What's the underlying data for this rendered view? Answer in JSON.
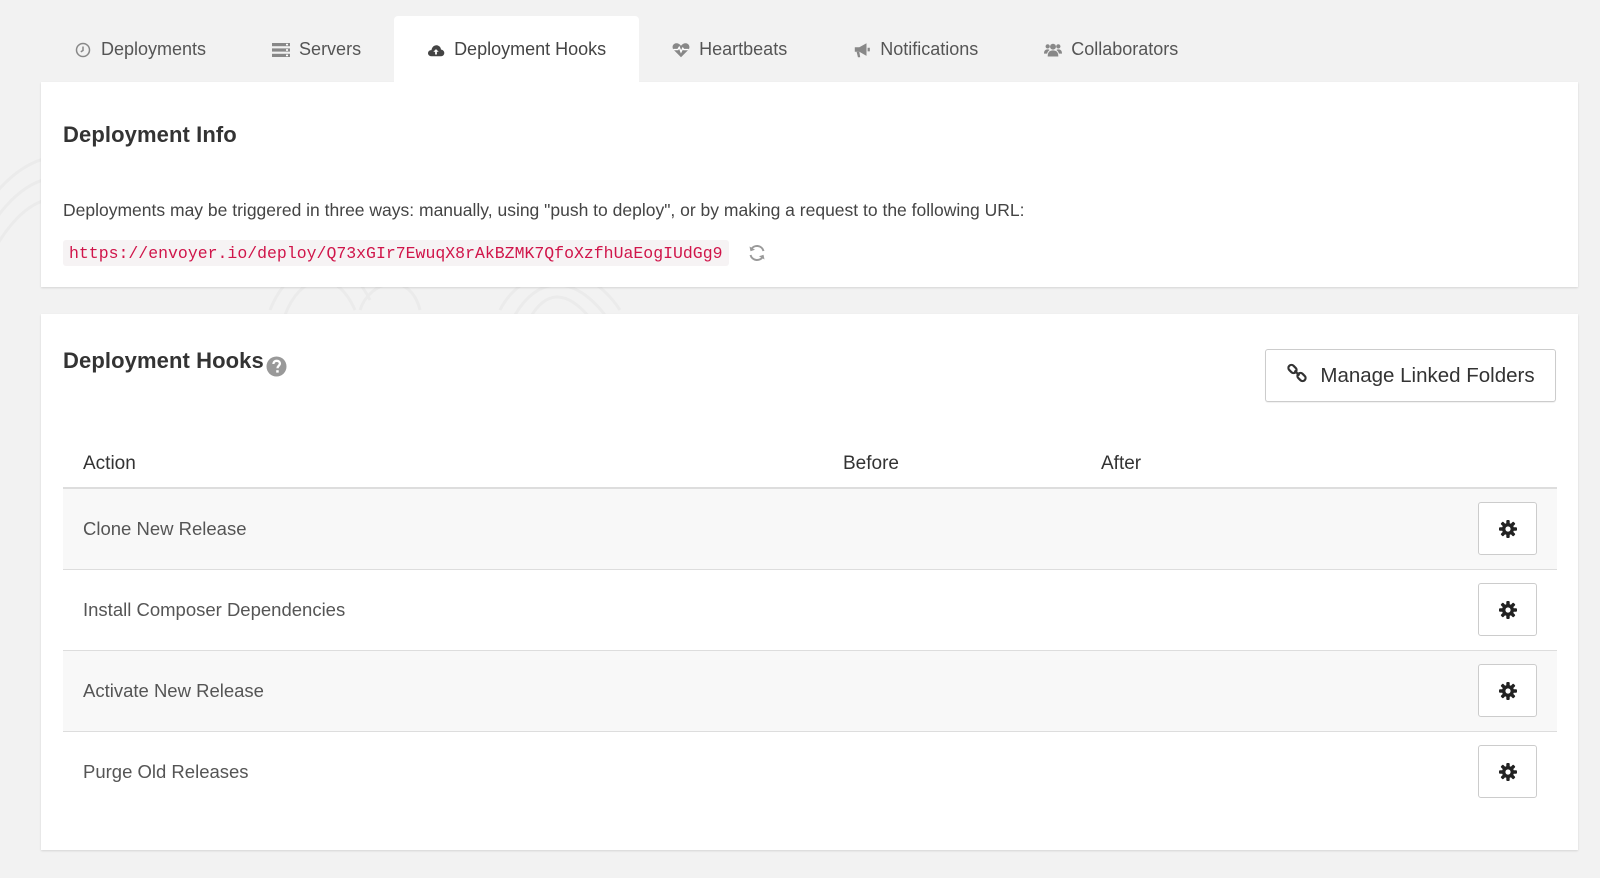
{
  "tabs": [
    {
      "label": "Deployments",
      "icon": "clock-icon",
      "active": false
    },
    {
      "label": "Servers",
      "icon": "server-icon",
      "active": false
    },
    {
      "label": "Deployment Hooks",
      "icon": "cloud-upload-icon",
      "active": true
    },
    {
      "label": "Heartbeats",
      "icon": "heartbeat-icon",
      "active": false
    },
    {
      "label": "Notifications",
      "icon": "bullhorn-icon",
      "active": false
    },
    {
      "label": "Collaborators",
      "icon": "users-icon",
      "active": false
    }
  ],
  "deployment_info": {
    "title": "Deployment Info",
    "description": "Deployments may be triggered in three ways: manually, using \"push to deploy\", or by making a request to the following URL:",
    "url": "https://envoyer.io/deploy/Q73xGIr7EwuqX8rAkBZMK7QfoXzfhUaEogIUdGg9"
  },
  "deployment_hooks": {
    "title": "Deployment Hooks",
    "manage_button_label": "Manage Linked Folders",
    "columns": [
      "Action",
      "Before",
      "After"
    ],
    "rows": [
      {
        "action": "Clone New Release",
        "before": "",
        "after": ""
      },
      {
        "action": "Install Composer Dependencies",
        "before": "",
        "after": ""
      },
      {
        "action": "Activate New Release",
        "before": "",
        "after": ""
      },
      {
        "action": "Purge Old Releases",
        "before": "",
        "after": ""
      }
    ]
  },
  "colors": {
    "page_bg": "#f2f2f2",
    "panel_bg": "#ffffff",
    "url_text": "#d0154a",
    "icon_gray": "#8a8a8a"
  }
}
